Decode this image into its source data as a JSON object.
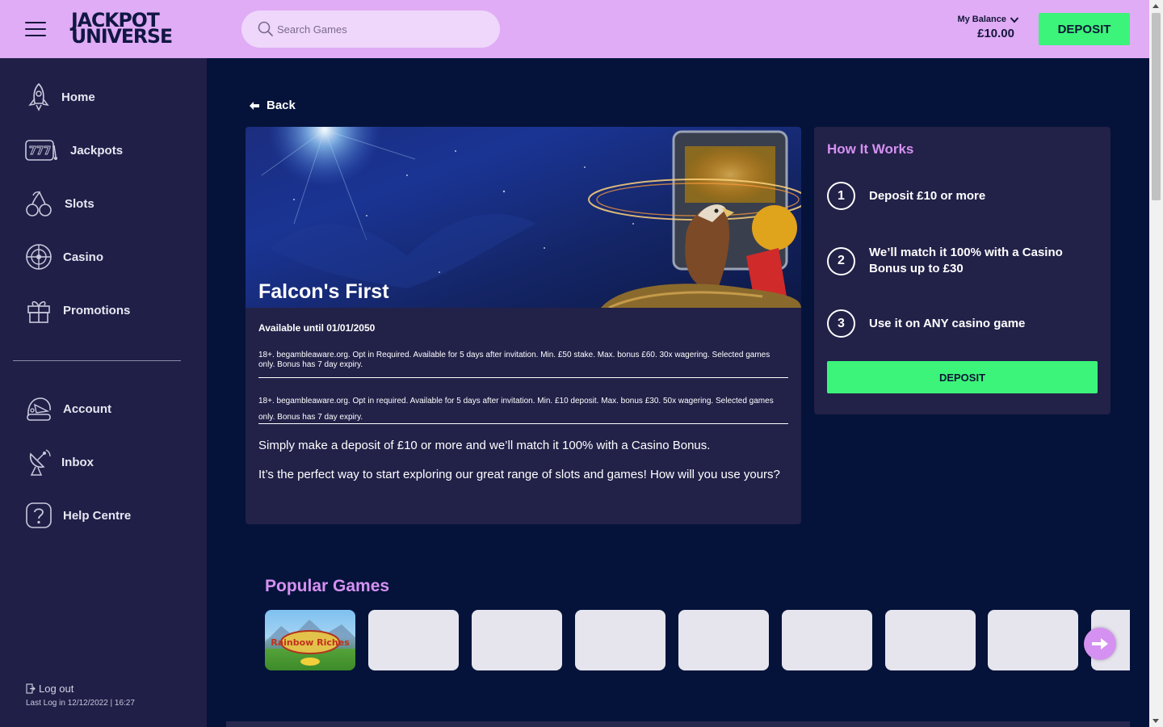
{
  "brand": {
    "line1": "JACKPOT",
    "line2": "UNIVERSE"
  },
  "search": {
    "placeholder": "Search Games"
  },
  "balance": {
    "label": "My Balance",
    "amount": "£10.00"
  },
  "header": {
    "deposit_label": "DEPOSIT"
  },
  "sidebar": {
    "items": [
      {
        "label": "Home",
        "icon": "rocket-icon"
      },
      {
        "label": "Jackpots",
        "icon": "slot-machine-icon"
      },
      {
        "label": "Slots",
        "icon": "cherries-icon"
      },
      {
        "label": "Casino",
        "icon": "roulette-icon"
      },
      {
        "label": "Promotions",
        "icon": "gift-icon"
      },
      {
        "label": "Account",
        "icon": "astronaut-helmet-icon"
      },
      {
        "label": "Inbox",
        "icon": "satellite-dish-icon"
      },
      {
        "label": "Help Centre",
        "icon": "question-icon"
      }
    ],
    "logout_label": "Log out",
    "last_login": "Last Log in 12/12/2022 | 16:27"
  },
  "promo": {
    "back_label": "Back",
    "title": "Falcon's First",
    "availability": "Available until 01/01/2050",
    "terms_1": "18+. begambleaware.org. Opt in Required. Available for 5 days after invitation. Min. £50 stake. Max. bonus £60. 30x wagering. Selected games only. Bonus has 7 day expiry.",
    "terms_2": "18+. begambleaware.org. Opt in required. Available for 5 days after invitation. Min. £10 deposit. Max. bonus £30. 50x wagering. Selected games only. Bonus has 7 day expiry.",
    "body_1": "Simply make a deposit of £10 or more and we’ll match it 100% with a Casino Bonus.",
    "body_2": "It’s the perfect way to start exploring our great range of slots and games! How will you use yours?"
  },
  "how_it_works": {
    "title": "How It Works",
    "steps": [
      {
        "num": "1",
        "text": "Deposit £10 or more"
      },
      {
        "num": "2",
        "text": "We’ll match it 100% with a Casino Bonus up to £30"
      },
      {
        "num": "3",
        "text": "Use it on ANY casino game"
      }
    ],
    "deposit_label": "DEPOSIT"
  },
  "popular_games": {
    "title": "Popular Games",
    "first_game_logo": "Rainbow Riches"
  },
  "colors": {
    "header_bg": "#e0acf5",
    "page_bg": "#05133a",
    "panel_bg": "#222148",
    "sidebar_bg": "#201f48",
    "accent_green": "#3cf47a",
    "accent_pink": "#d591f1"
  }
}
